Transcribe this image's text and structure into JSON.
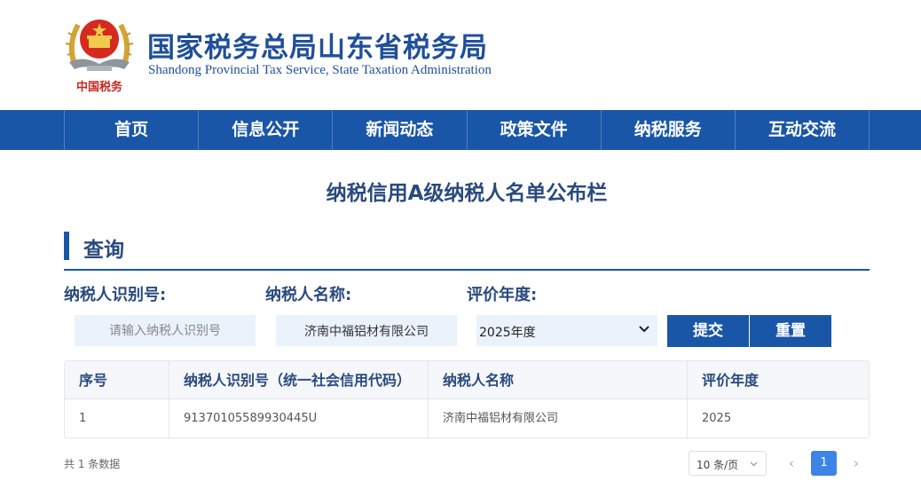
{
  "header": {
    "title": "国家税务总局山东省税务局",
    "subtitle": "Shandong Provincial Tax Service, State Taxation Administration",
    "emblem_text": "中国税务"
  },
  "nav": {
    "items": [
      "首页",
      "信息公开",
      "新闻动态",
      "政策文件",
      "纳税服务",
      "互动交流"
    ]
  },
  "page_title": "纳税信用A级纳税人名单公布栏",
  "query": {
    "section_title": "查询",
    "id_label": "纳税人识别号:",
    "id_placeholder": "请输入纳税人识别号",
    "id_value": "",
    "name_label": "纳税人名称:",
    "name_value": "济南中福铝材有限公司",
    "year_label": "评价年度:",
    "year_value": "2025年度",
    "submit_label": "提交",
    "reset_label": "重置"
  },
  "table": {
    "headers": [
      "序号",
      "纳税人识别号（统一社会信用代码）",
      "纳税人名称",
      "评价年度"
    ],
    "rows": [
      [
        "1",
        "91370105589930445U",
        "济南中福铝材有限公司",
        "2025"
      ]
    ]
  },
  "footer": {
    "total_text": "共 1 条数据",
    "page_size": "10 条/页",
    "current_page": "1",
    "prev": "‹",
    "next": "›"
  },
  "colors": {
    "brand_blue": "#1a56a7",
    "heading_blue": "#2a4a7e",
    "input_bg": "#eaf2fb",
    "active_page": "#3c85e6"
  }
}
